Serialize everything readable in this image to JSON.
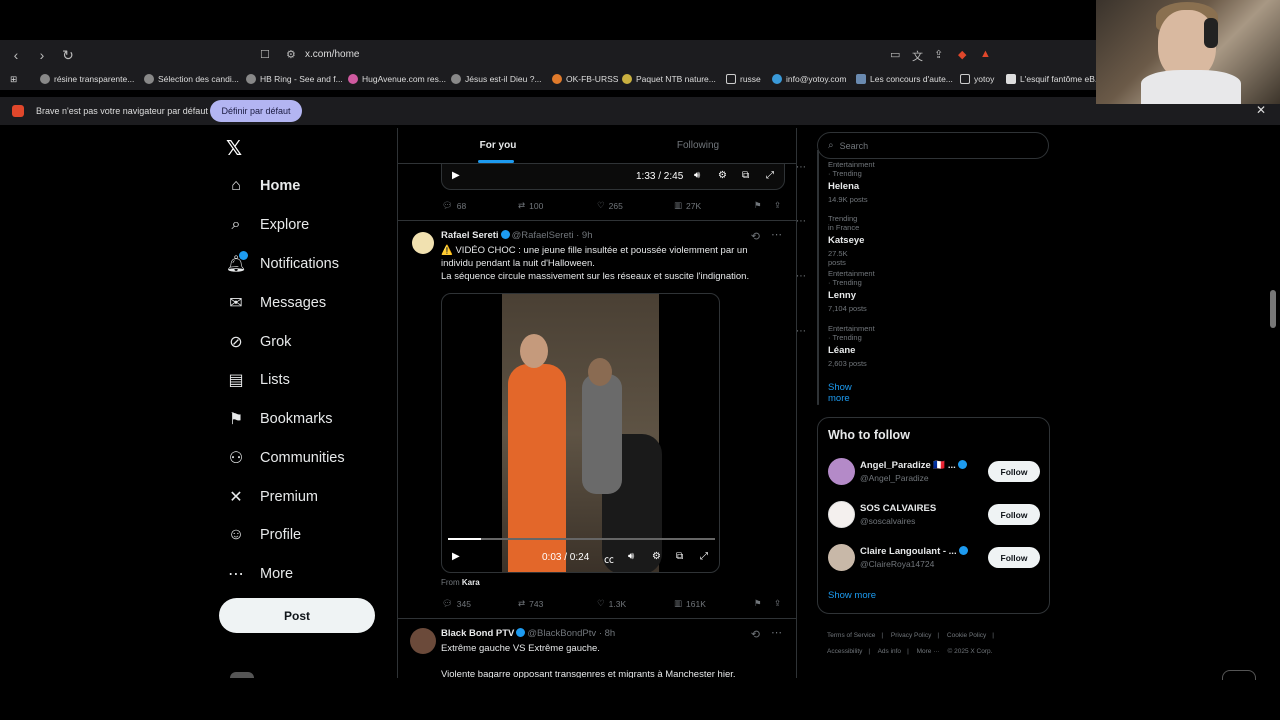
{
  "browser": {
    "url": "x.com/home",
    "bookmarks": [
      "résine transparente...",
      "Sélection des candi...",
      "HB Ring - See and f...",
      "HugAvenue.com res...",
      "Jésus est-il Dieu ?...",
      "OK-FB-URSS",
      "Paquet NTB nature...",
      "russe",
      "info@yotoy.com",
      "Les concours d'aute...",
      "yotoy",
      "L'esquif fantôme eB..."
    ],
    "infobar": {
      "message": "Brave n'est pas votre navigateur par défaut",
      "button": "Définir par défaut"
    }
  },
  "nav": {
    "items": [
      {
        "label": "Home",
        "icon": "home-icon"
      },
      {
        "label": "Explore",
        "icon": "search-icon"
      },
      {
        "label": "Notifications",
        "icon": "bell-icon"
      },
      {
        "label": "Messages",
        "icon": "mail-icon"
      },
      {
        "label": "Grok",
        "icon": "grok-icon"
      },
      {
        "label": "Lists",
        "icon": "list-icon"
      },
      {
        "label": "Bookmarks",
        "icon": "bookmark-icon"
      },
      {
        "label": "Communities",
        "icon": "people-icon"
      },
      {
        "label": "Premium",
        "icon": "x-icon"
      },
      {
        "label": "Profile",
        "icon": "person-icon"
      },
      {
        "label": "More",
        "icon": "more-circle-icon"
      }
    ],
    "post": "Post",
    "notifications_badge": "4"
  },
  "feed": {
    "tabs": [
      "For you",
      "Following"
    ],
    "tweet0": {
      "video_time": "1:33 / 2:45",
      "replies": "68",
      "reposts": "100",
      "likes": "265",
      "views": "27K"
    },
    "tweet1": {
      "name": "Rafael Sereti",
      "handle": "@RafaelSereti",
      "time": "· 9h",
      "text_line1": "⚠️ VIDÉO CHOC : une jeune fille insultée et poussée violemment par un",
      "text_line2": "individu pendant la nuit d'Halloween.",
      "text_line3": "La séquence circule massivement sur les réseaux et suscite l'indignation.",
      "video_time": "0:03 / 0:24",
      "video_progress": 0.125,
      "from_label": "From",
      "from_name": "Kara",
      "replies": "345",
      "reposts": "743",
      "likes": "1.3K",
      "views": "161K"
    },
    "tweet2": {
      "name": "Black Bond PTV",
      "handle": "@BlackBondPtv",
      "time": "· 8h",
      "text_line1": "Extrême gauche VS Extrême gauche.",
      "text_line2": "Violente bagarre opposant transgenres et migrants à Manchester hier."
    }
  },
  "sidebar": {
    "search_placeholder": "Search",
    "trends": [
      {
        "category": "Entertainment · Trending",
        "name": "Helena",
        "count": "14.9K posts"
      },
      {
        "category": "Trending in France",
        "name": "Katseye",
        "count": "27.5K posts"
      },
      {
        "category": "Entertainment · Trending",
        "name": "Lenny",
        "count": "7,104 posts"
      },
      {
        "category": "Entertainment · Trending",
        "name": "Léane",
        "count": "2,603 posts"
      }
    ],
    "show_more": "Show more",
    "who_to_follow": {
      "title": "Who to follow",
      "accounts": [
        {
          "name": "Angel_Paradize 🇫🇷 ...",
          "handle": "@Angel_Paradize"
        },
        {
          "name": "SOS CALVAIRES",
          "handle": "@soscalvaires"
        },
        {
          "name": "Claire Langoulant - ...",
          "handle": "@ClaireRoya14724"
        }
      ],
      "follow": "Follow",
      "show_more": "Show more"
    },
    "footer": [
      "Terms of Service",
      "|",
      "Privacy Policy",
      "|",
      "Cookie Policy",
      "|",
      "Accessibility",
      "|",
      "Ads info",
      "|",
      "More ···",
      "© 2025 X Corp."
    ]
  },
  "colors": {
    "accent": "#1d9bf0",
    "background": "#000000",
    "border": "#2f3336",
    "muted": "#71767b"
  }
}
